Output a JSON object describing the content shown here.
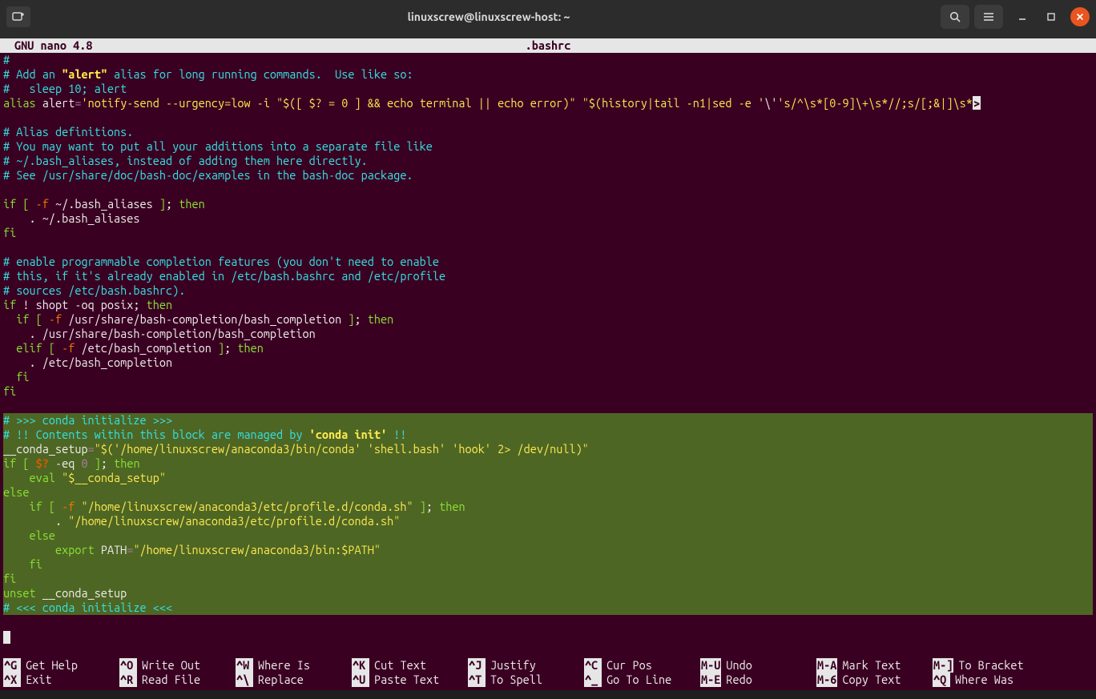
{
  "titlebar": {
    "title": "linuxscrew@linuxscrew-host: ~"
  },
  "nano": {
    "program": "GNU nano 4.8",
    "filename": ".bashrc"
  },
  "lines": [
    {
      "sel": false,
      "spans": [
        {
          "c": "cyan",
          "t": "#"
        }
      ]
    },
    {
      "sel": false,
      "spans": [
        {
          "c": "cyan",
          "t": "# Add an "
        },
        {
          "c": "yellow-b",
          "t": "\"alert\""
        },
        {
          "c": "cyan",
          "t": " alias for long running commands.  Use like so:"
        }
      ]
    },
    {
      "sel": false,
      "spans": [
        {
          "c": "cyan",
          "t": "#   sleep 10; alert"
        }
      ]
    },
    {
      "sel": false,
      "spans": [
        {
          "c": "green",
          "t": "alias"
        },
        {
          "c": "white",
          "t": " alert"
        },
        {
          "c": "magenta",
          "t": "="
        },
        {
          "c": "yellow",
          "t": "'notify-send --urgency=low -i \"$([ $? = 0 ] && echo terminal || echo error)\" \"$(history|tail -n1|sed -e '"
        },
        {
          "c": "white",
          "t": "\\'"
        },
        {
          "c": "yellow",
          "t": "'s/^\\s*[0-9]\\+\\s*//;s/[;&|]\\s*"
        },
        {
          "c": "trunc",
          "t": ">"
        }
      ]
    },
    {
      "sel": false,
      "spans": []
    },
    {
      "sel": false,
      "spans": [
        {
          "c": "cyan",
          "t": "# Alias definitions."
        }
      ]
    },
    {
      "sel": false,
      "spans": [
        {
          "c": "cyan",
          "t": "# You may want to put all your additions into a separate file like"
        }
      ]
    },
    {
      "sel": false,
      "spans": [
        {
          "c": "cyan",
          "t": "# ~/.bash_aliases, instead of adding them here directly."
        }
      ]
    },
    {
      "sel": false,
      "spans": [
        {
          "c": "cyan",
          "t": "# See /usr/share/doc/bash-doc/examples in the bash-doc package."
        }
      ]
    },
    {
      "sel": false,
      "spans": []
    },
    {
      "sel": false,
      "spans": [
        {
          "c": "green",
          "t": "if"
        },
        {
          "c": "white",
          "t": " "
        },
        {
          "c": "green",
          "t": "["
        },
        {
          "c": "white",
          "t": " "
        },
        {
          "c": "orange",
          "t": "-f"
        },
        {
          "c": "white",
          "t": " ~/.bash_aliases "
        },
        {
          "c": "green",
          "t": "]"
        },
        {
          "c": "white",
          "t": "; "
        },
        {
          "c": "green",
          "t": "then"
        }
      ]
    },
    {
      "sel": false,
      "spans": [
        {
          "c": "white",
          "t": "    . ~/.bash_aliases"
        }
      ]
    },
    {
      "sel": false,
      "spans": [
        {
          "c": "green",
          "t": "fi"
        }
      ]
    },
    {
      "sel": false,
      "spans": []
    },
    {
      "sel": false,
      "spans": [
        {
          "c": "cyan",
          "t": "# enable programmable completion features (you don't need to enable"
        }
      ]
    },
    {
      "sel": false,
      "spans": [
        {
          "c": "cyan",
          "t": "# this, if it's already enabled in /etc/bash.bashrc and /etc/profile"
        }
      ]
    },
    {
      "sel": false,
      "spans": [
        {
          "c": "cyan",
          "t": "# sources /etc/bash.bashrc)."
        }
      ]
    },
    {
      "sel": false,
      "spans": [
        {
          "c": "green",
          "t": "if"
        },
        {
          "c": "white",
          "t": " ! shopt -oq posix; "
        },
        {
          "c": "green",
          "t": "then"
        }
      ]
    },
    {
      "sel": false,
      "spans": [
        {
          "c": "white",
          "t": "  "
        },
        {
          "c": "green",
          "t": "if"
        },
        {
          "c": "white",
          "t": " "
        },
        {
          "c": "green",
          "t": "["
        },
        {
          "c": "white",
          "t": " "
        },
        {
          "c": "orange",
          "t": "-f"
        },
        {
          "c": "white",
          "t": " /usr/share/bash-completion/bash_completion "
        },
        {
          "c": "green",
          "t": "]"
        },
        {
          "c": "white",
          "t": "; "
        },
        {
          "c": "green",
          "t": "then"
        }
      ]
    },
    {
      "sel": false,
      "spans": [
        {
          "c": "white",
          "t": "    . /usr/share/bash-completion/bash_completion"
        }
      ]
    },
    {
      "sel": false,
      "spans": [
        {
          "c": "white",
          "t": "  "
        },
        {
          "c": "green",
          "t": "elif"
        },
        {
          "c": "white",
          "t": " "
        },
        {
          "c": "green",
          "t": "["
        },
        {
          "c": "white",
          "t": " "
        },
        {
          "c": "orange",
          "t": "-f"
        },
        {
          "c": "white",
          "t": " /etc/bash_completion "
        },
        {
          "c": "green",
          "t": "]"
        },
        {
          "c": "white",
          "t": "; "
        },
        {
          "c": "green",
          "t": "then"
        }
      ]
    },
    {
      "sel": false,
      "spans": [
        {
          "c": "white",
          "t": "    . /etc/bash_completion"
        }
      ]
    },
    {
      "sel": false,
      "spans": [
        {
          "c": "white",
          "t": "  "
        },
        {
          "c": "green",
          "t": "fi"
        }
      ]
    },
    {
      "sel": false,
      "spans": [
        {
          "c": "green",
          "t": "fi"
        }
      ]
    },
    {
      "sel": false,
      "spans": []
    },
    {
      "sel": true,
      "spans": [
        {
          "c": "cyan",
          "t": "# >>> conda initialize >>>"
        }
      ]
    },
    {
      "sel": true,
      "spans": [
        {
          "c": "cyan",
          "t": "# !! Contents within this block are managed by "
        },
        {
          "c": "yellow-b",
          "t": "'conda init'"
        },
        {
          "c": "cyan",
          "t": " !!"
        }
      ]
    },
    {
      "sel": true,
      "spans": [
        {
          "c": "white",
          "t": "__conda_setup"
        },
        {
          "c": "magenta",
          "t": "="
        },
        {
          "c": "yellow",
          "t": "\"$('/home/linuxscrew/anaconda3/bin/conda' 'shell.bash' 'hook' 2> /dev/null)\""
        }
      ]
    },
    {
      "sel": true,
      "spans": [
        {
          "c": "green",
          "t": "if"
        },
        {
          "c": "white",
          "t": " "
        },
        {
          "c": "green",
          "t": "["
        },
        {
          "c": "white",
          "t": " "
        },
        {
          "c": "orange-b",
          "t": "$?"
        },
        {
          "c": "white",
          "t": " -eq "
        },
        {
          "c": "magenta",
          "t": "0"
        },
        {
          "c": "white",
          "t": " "
        },
        {
          "c": "green",
          "t": "]"
        },
        {
          "c": "white",
          "t": "; "
        },
        {
          "c": "green",
          "t": "then"
        }
      ]
    },
    {
      "sel": true,
      "spans": [
        {
          "c": "white",
          "t": "    "
        },
        {
          "c": "green",
          "t": "eval"
        },
        {
          "c": "white",
          "t": " "
        },
        {
          "c": "yellow",
          "t": "\"$__conda_setup\""
        }
      ]
    },
    {
      "sel": true,
      "spans": [
        {
          "c": "green",
          "t": "else"
        }
      ]
    },
    {
      "sel": true,
      "spans": [
        {
          "c": "white",
          "t": "    "
        },
        {
          "c": "green",
          "t": "if"
        },
        {
          "c": "white",
          "t": " "
        },
        {
          "c": "green",
          "t": "["
        },
        {
          "c": "white",
          "t": " "
        },
        {
          "c": "orange",
          "t": "-f"
        },
        {
          "c": "white",
          "t": " "
        },
        {
          "c": "yellow",
          "t": "\"/home/linuxscrew/anaconda3/etc/profile.d/conda.sh\""
        },
        {
          "c": "white",
          "t": " "
        },
        {
          "c": "green",
          "t": "]"
        },
        {
          "c": "white",
          "t": "; "
        },
        {
          "c": "green",
          "t": "then"
        }
      ]
    },
    {
      "sel": true,
      "spans": [
        {
          "c": "white",
          "t": "        . "
        },
        {
          "c": "yellow",
          "t": "\"/home/linuxscrew/anaconda3/etc/profile.d/conda.sh\""
        }
      ]
    },
    {
      "sel": true,
      "spans": [
        {
          "c": "white",
          "t": "    "
        },
        {
          "c": "green",
          "t": "else"
        }
      ]
    },
    {
      "sel": true,
      "spans": [
        {
          "c": "white",
          "t": "        "
        },
        {
          "c": "green",
          "t": "export"
        },
        {
          "c": "white",
          "t": " PATH"
        },
        {
          "c": "magenta",
          "t": "="
        },
        {
          "c": "yellow",
          "t": "\"/home/linuxscrew/anaconda3/bin:$PATH\""
        }
      ]
    },
    {
      "sel": true,
      "spans": [
        {
          "c": "white",
          "t": "    "
        },
        {
          "c": "green",
          "t": "fi"
        }
      ]
    },
    {
      "sel": true,
      "spans": [
        {
          "c": "green",
          "t": "fi"
        }
      ]
    },
    {
      "sel": true,
      "spans": [
        {
          "c": "green",
          "t": "unset"
        },
        {
          "c": "white",
          "t": " __conda_setup"
        }
      ]
    },
    {
      "sel": true,
      "spans": [
        {
          "c": "cyan",
          "t": "# <<< conda initialize <<<"
        }
      ]
    },
    {
      "sel": false,
      "spans": []
    },
    {
      "sel": false,
      "spans": [
        {
          "c": "cursor",
          "t": " "
        }
      ]
    }
  ],
  "shortcuts": {
    "row1": [
      {
        "k": "^G",
        "l": "Get Help"
      },
      {
        "k": "^O",
        "l": "Write Out"
      },
      {
        "k": "^W",
        "l": "Where Is"
      },
      {
        "k": "^K",
        "l": "Cut Text"
      },
      {
        "k": "^J",
        "l": "Justify"
      },
      {
        "k": "^C",
        "l": "Cur Pos"
      },
      {
        "k": "M-U",
        "l": "Undo"
      },
      {
        "k": "M-A",
        "l": "Mark Text"
      },
      {
        "k": "M-]",
        "l": "To Bracket"
      }
    ],
    "row2": [
      {
        "k": "^X",
        "l": "Exit"
      },
      {
        "k": "^R",
        "l": "Read File"
      },
      {
        "k": "^\\",
        "l": "Replace"
      },
      {
        "k": "^U",
        "l": "Paste Text"
      },
      {
        "k": "^T",
        "l": "To Spell"
      },
      {
        "k": "^_",
        "l": "Go To Line"
      },
      {
        "k": "M-E",
        "l": "Redo"
      },
      {
        "k": "M-6",
        "l": "Copy Text"
      },
      {
        "k": "^Q",
        "l": "Where Was"
      }
    ]
  }
}
